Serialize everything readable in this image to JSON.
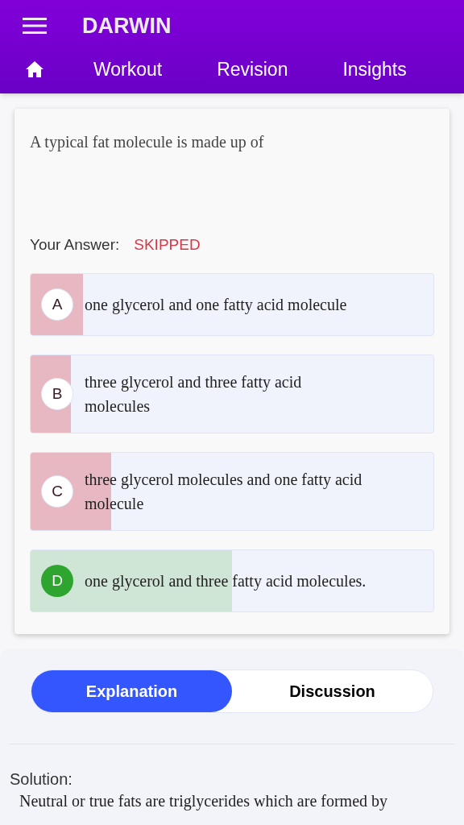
{
  "app_bar": {
    "title": "DARWIN"
  },
  "nav": [
    {
      "kind": "home",
      "selected": false
    },
    {
      "kind": "text",
      "label": "Workout",
      "selected": false
    },
    {
      "kind": "text",
      "label": "Revision",
      "selected": false
    },
    {
      "kind": "text",
      "label": "Insights",
      "selected": false
    }
  ],
  "question": {
    "text": "A typical fat molecule is made up of",
    "answer_label": "Your Answer:",
    "answer_value": "SKIPPED"
  },
  "options": [
    {
      "letter": "A",
      "text": "one glycerol and one fatty acid molecule",
      "correct": false,
      "level": 0.13
    },
    {
      "letter": "B",
      "text": "three glycerol and three fatty acid molecules",
      "correct": false,
      "level": 0.1
    },
    {
      "letter": "C",
      "text": "three glycerol molecules and one fatty acid molecule",
      "correct": false,
      "level": 0.2
    },
    {
      "letter": "D",
      "text": "one glycerol and three fatty acid molecules.",
      "correct": true,
      "level": 0.5
    }
  ],
  "tabs": [
    {
      "label": "Explanation",
      "selected": true
    },
    {
      "label": "Discussion",
      "selected": false
    }
  ],
  "solution": {
    "heading": "Solution:",
    "text": "Neutral or true fats are triglycerides which are formed by"
  }
}
